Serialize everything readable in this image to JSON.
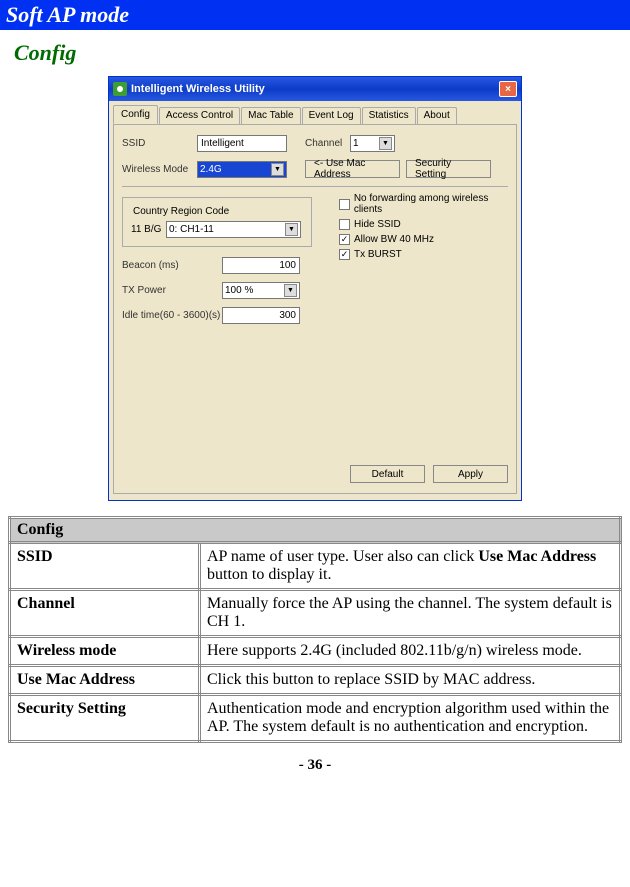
{
  "page": {
    "title": "Soft AP mode",
    "section_heading": "Config",
    "footer": "- 36 -"
  },
  "app": {
    "title": "Intelligent Wireless Utility",
    "close_label": "×",
    "tabs": [
      "Config",
      "Access Control",
      "Mac Table",
      "Event Log",
      "Statistics",
      "About"
    ],
    "active_tab": 0,
    "fields": {
      "ssid_label": "SSID",
      "ssid_value": "Intelligent",
      "channel_label": "Channel",
      "channel_value": "1",
      "wireless_mode_label": "Wireless Mode",
      "wireless_mode_value": "2.4G",
      "use_mac_btn": "<- Use Mac Address",
      "security_btn": "Security Setting",
      "country_legend": "Country Region Code",
      "country_band": "11 B/G",
      "country_value": "0: CH1-11",
      "beacon_label": "Beacon (ms)",
      "beacon_value": "100",
      "tx_power_label": "TX Power",
      "tx_power_value": "100 %",
      "idle_label": "Idle time(60 - 3600)(s)",
      "idle_value": "300"
    },
    "checks": {
      "no_fwd": "No forwarding among wireless clients",
      "hide_ssid": "Hide SSID",
      "allow_bw": "Allow BW 40 MHz",
      "tx_burst": "Tx BURST"
    },
    "buttons": {
      "default": "Default",
      "apply": "Apply"
    }
  },
  "config_table": {
    "header": "Config",
    "rows": [
      {
        "name": "SSID",
        "desc_pre": "AP name of user type. User also can click ",
        "desc_bold": "Use Mac Address",
        "desc_post": " button to display it."
      },
      {
        "name": "Channel",
        "desc_pre": "Manually force the AP using the channel. The system default is CH 1.",
        "desc_bold": "",
        "desc_post": ""
      },
      {
        "name": "Wireless mode",
        "desc_pre": "Here supports 2.4G (included 802.11b/g/n) wireless mode.",
        "desc_bold": "",
        "desc_post": ""
      },
      {
        "name": "Use Mac Address",
        "desc_pre": "Click this button to replace SSID by MAC address.",
        "desc_bold": "",
        "desc_post": ""
      },
      {
        "name": "Security Setting",
        "desc_pre": "Authentication mode and encryption algorithm used within the AP. The system default is no authentication and encryption.",
        "desc_bold": "",
        "desc_post": ""
      }
    ]
  }
}
